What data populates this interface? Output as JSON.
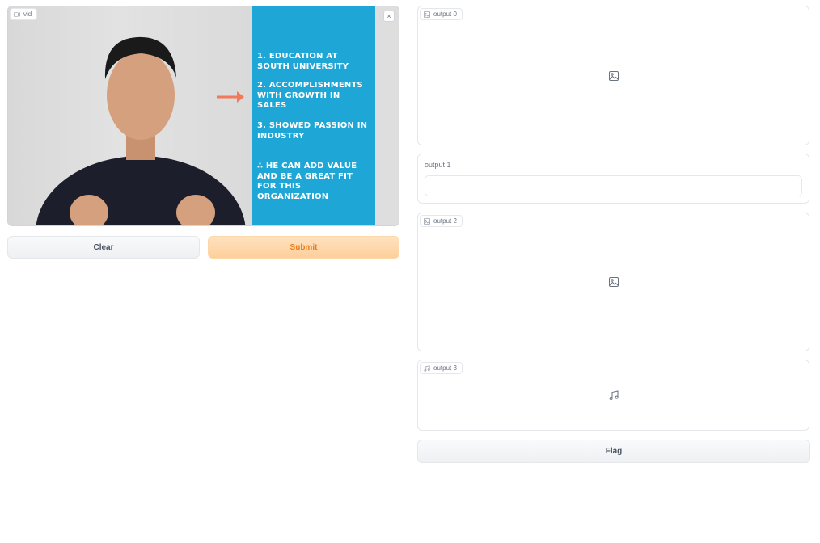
{
  "input": {
    "video_label": "vid",
    "close_symbol": "×",
    "slide": {
      "items": [
        "1. Education at South University",
        "2. Accomplishments with growth in sales",
        "3. Showed passion in industry",
        "∴  He can add value and be a great fit for this organization"
      ]
    }
  },
  "buttons": {
    "clear": "Clear",
    "submit": "Submit",
    "flag": "Flag"
  },
  "outputs": {
    "out0_label": "output 0",
    "out1_label": "output 1",
    "out1_value": "",
    "out2_label": "output 2",
    "out3_label": "output 3"
  },
  "icons": [
    "video-icon",
    "image-icon",
    "music-icon",
    "close-icon",
    "arrow-right-icon"
  ],
  "colors": {
    "slide_bg": "#1ea6d6",
    "arrow": "#f07a5a",
    "submit_bg": "#fdcf9b",
    "submit_text": "#ea7c1d"
  }
}
